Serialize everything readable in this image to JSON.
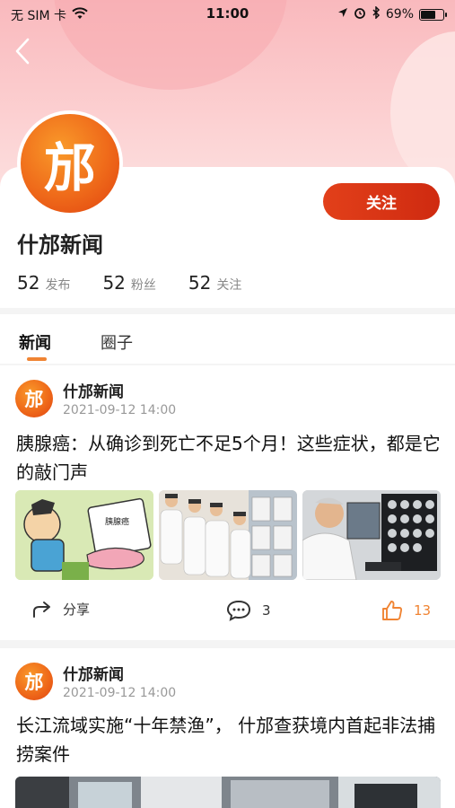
{
  "status_bar": {
    "carrier": "无 SIM 卡",
    "time": "11:00",
    "battery": "69%",
    "battery_level": 0.69
  },
  "profile": {
    "logo_text": "邡",
    "name": "什邡新闻",
    "follow_label": "关注",
    "stats": [
      {
        "num": "52",
        "label": "发布"
      },
      {
        "num": "52",
        "label": "粉丝"
      },
      {
        "num": "52",
        "label": "关注"
      }
    ]
  },
  "tabs": [
    {
      "label": "新闻"
    },
    {
      "label": "圈子"
    }
  ],
  "posts": [
    {
      "author": "什邡新闻",
      "date": "2021-09-12  14:00",
      "title": "胰腺癌：从确诊到死亡不足5个月！这些症状，都是它的敲门声",
      "image_caption": "胰腺癌",
      "share_label": "分享",
      "comments": "3",
      "likes": "13"
    },
    {
      "author": "什邡新闻",
      "date": "2021-09-12  14:00",
      "title": "长江流域实施“十年禁渔”， 什邡查获境内首起非法捕捞案件"
    }
  ],
  "colors": {
    "accent": "#f08433",
    "follow": "#d93416",
    "header_pink": "#f9b9bd"
  }
}
